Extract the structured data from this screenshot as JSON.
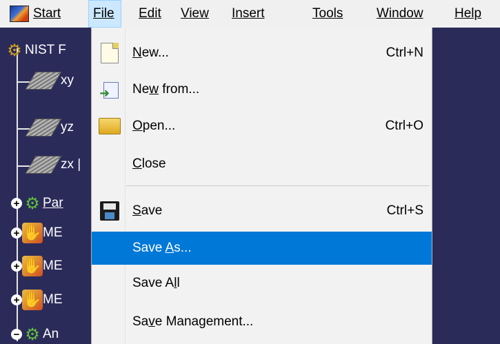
{
  "menubar": {
    "start": "Start",
    "file": "File",
    "edit": "Edit",
    "view": "View",
    "insert": "Insert",
    "tools": "Tools",
    "window": "Window",
    "help": "Help"
  },
  "tree": {
    "root": "NIST F",
    "xy": "xy",
    "yz": "yz",
    "zx": "zx |",
    "part": "Par",
    "me1": "ME",
    "me2": "ME",
    "me3": "ME",
    "an": "An"
  },
  "file_menu": {
    "items": [
      {
        "label_pre": "",
        "label_ul": "N",
        "label_post": "ew...",
        "shortcut": "Ctrl+N"
      },
      {
        "label_pre": "Ne",
        "label_ul": "w",
        "label_post": " from...",
        "shortcut": ""
      },
      {
        "label_pre": "",
        "label_ul": "O",
        "label_post": "pen...",
        "shortcut": "Ctrl+O"
      },
      {
        "label_pre": "",
        "label_ul": "C",
        "label_post": "lose",
        "shortcut": ""
      },
      {
        "label_pre": "",
        "label_ul": "S",
        "label_post": "ave",
        "shortcut": "Ctrl+S"
      },
      {
        "label_pre": "Save ",
        "label_ul": "A",
        "label_post": "s...",
        "shortcut": ""
      },
      {
        "label_pre": "Save A",
        "label_ul": "l",
        "label_post": "l",
        "shortcut": ""
      },
      {
        "label_pre": "Sa",
        "label_ul": "v",
        "label_post": "e Management...",
        "shortcut": ""
      }
    ]
  },
  "colors": {
    "selection": "#0078d7",
    "background": "#2b2b5a",
    "menu_bg": "#f2f2f2"
  }
}
